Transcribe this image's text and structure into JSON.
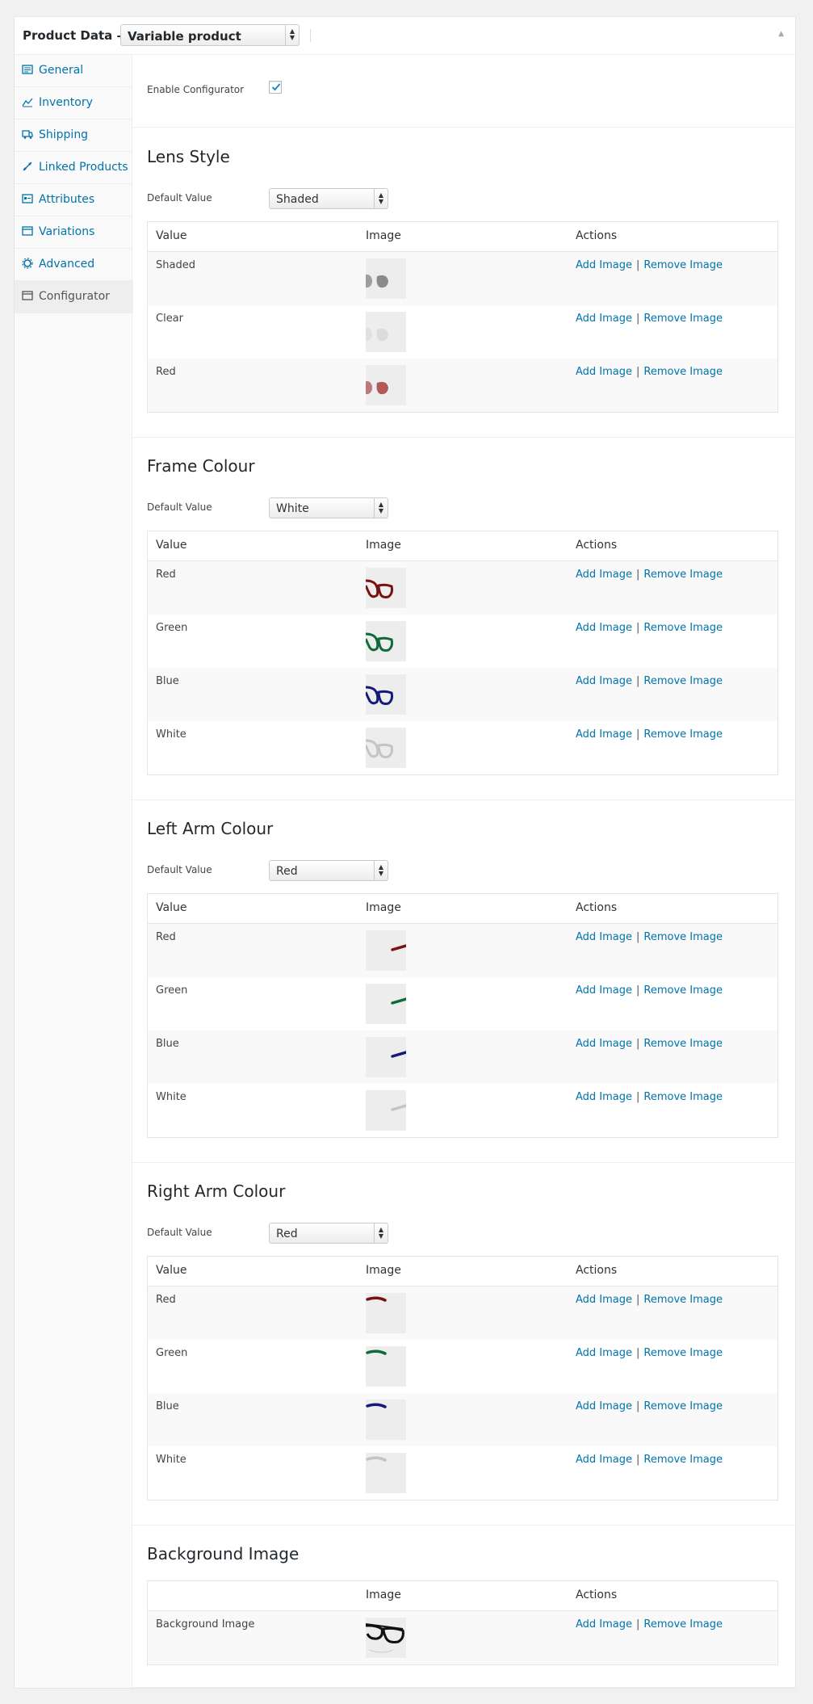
{
  "header": {
    "title": "Product Data —",
    "product_type": "Variable product"
  },
  "sidebar": {
    "items": [
      {
        "label": "General",
        "icon": "general-icon"
      },
      {
        "label": "Inventory",
        "icon": "inventory-icon"
      },
      {
        "label": "Shipping",
        "icon": "shipping-icon"
      },
      {
        "label": "Linked Products",
        "icon": "linked-products-icon"
      },
      {
        "label": "Attributes",
        "icon": "attributes-icon"
      },
      {
        "label": "Variations",
        "icon": "variations-icon"
      },
      {
        "label": "Advanced",
        "icon": "advanced-icon"
      },
      {
        "label": "Configurator",
        "icon": "configurator-icon"
      }
    ],
    "active": "Configurator"
  },
  "enable_configurator": {
    "label": "Enable Configurator",
    "checked": true
  },
  "common": {
    "default_value_label": "Default Value",
    "col_value": "Value",
    "col_image": "Image",
    "col_actions": "Actions",
    "add_image": "Add Image",
    "separator": "|",
    "remove_image": "Remove Image"
  },
  "sections": [
    {
      "title": "Lens Style",
      "default_value": "Shaded",
      "part": "lens",
      "rows": [
        {
          "value": "Shaded",
          "color": "#8a8a8a"
        },
        {
          "value": "Clear",
          "color": "#dcdcdc"
        },
        {
          "value": "Red",
          "color": "#b05a5a"
        }
      ]
    },
    {
      "title": "Frame Colour",
      "default_value": "White",
      "part": "frame",
      "rows": [
        {
          "value": "Red",
          "color": "#7a1010"
        },
        {
          "value": "Green",
          "color": "#0f6b3a"
        },
        {
          "value": "Blue",
          "color": "#141a78"
        },
        {
          "value": "White",
          "color": "#c4c4c4"
        }
      ]
    },
    {
      "title": "Left Arm Colour",
      "default_value": "Red",
      "part": "left-arm",
      "rows": [
        {
          "value": "Red",
          "color": "#7a1010"
        },
        {
          "value": "Green",
          "color": "#0f6b3a"
        },
        {
          "value": "Blue",
          "color": "#141a78"
        },
        {
          "value": "White",
          "color": "#c4c4c4"
        }
      ]
    },
    {
      "title": "Right Arm Colour",
      "default_value": "Red",
      "part": "right-arm",
      "rows": [
        {
          "value": "Red",
          "color": "#7a1010"
        },
        {
          "value": "Green",
          "color": "#0f6b3a"
        },
        {
          "value": "Blue",
          "color": "#141a78"
        },
        {
          "value": "White",
          "color": "#c4c4c4"
        }
      ]
    },
    {
      "title": "Background Image",
      "default_value": null,
      "part": "background",
      "rows": [
        {
          "value": "Background Image",
          "color": "#111111"
        }
      ]
    }
  ]
}
